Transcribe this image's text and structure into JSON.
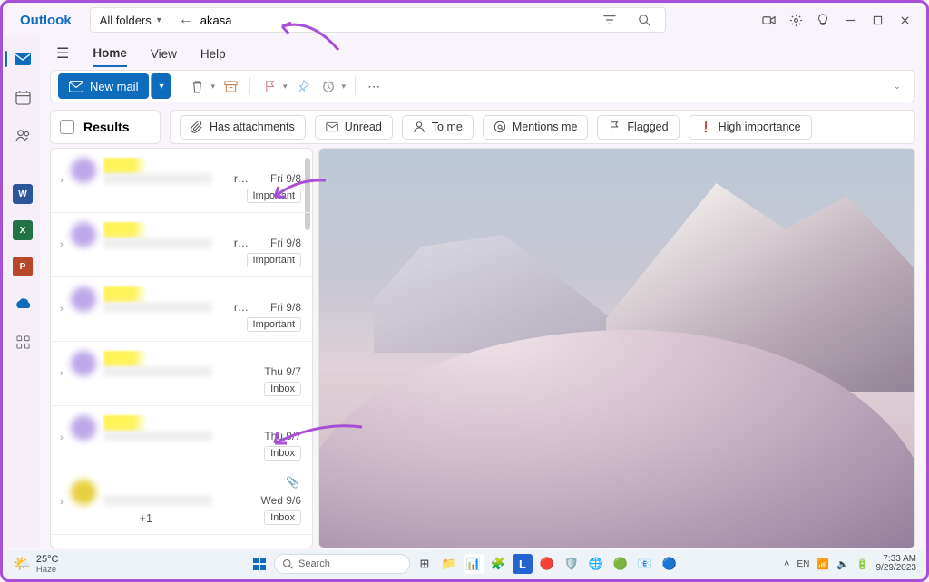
{
  "app": {
    "name": "Outlook"
  },
  "titlebar": {
    "folder_scope": "All folders",
    "search_value": "akasa"
  },
  "toolbar_icons": {
    "filter": "filter-icon",
    "search": "search-icon",
    "meet": "meet-now-icon",
    "settings": "gear-icon",
    "tips": "lightbulb-icon",
    "min": "minimize-icon",
    "max": "maximize-icon",
    "close": "close-icon"
  },
  "tabs": {
    "home": "Home",
    "view": "View",
    "help": "Help"
  },
  "ribbon": {
    "new_mail": "New mail"
  },
  "results_header": "Results",
  "filters": {
    "has_attachments": "Has attachments",
    "unread": "Unread",
    "to_me": "To me",
    "mentions_me": "Mentions me",
    "flagged": "Flagged",
    "high_importance": "High importance"
  },
  "messages": [
    {
      "sender_r": "r…",
      "date": "Fri 9/8",
      "folder": "Important",
      "avatar": "#bda7e9",
      "highlight": true
    },
    {
      "sender_r": "r…",
      "date": "Fri 9/8",
      "folder": "Important",
      "avatar": "#bda7e9",
      "highlight": true
    },
    {
      "sender_r": "r…",
      "date": "Fri 9/8",
      "folder": "Important",
      "avatar": "#bda7e9",
      "highlight": true
    },
    {
      "sender_r": "",
      "date": "Thu 9/7",
      "folder": "Inbox",
      "avatar": "#bda7e9",
      "highlight": true
    },
    {
      "sender_r": "",
      "date": "Thu 9/7",
      "folder": "Inbox",
      "avatar": "#bda7e9",
      "highlight": true
    },
    {
      "sender_r": "",
      "date": "Wed 9/6",
      "folder": "Inbox",
      "avatar": "#e6cf3f",
      "highlight": false,
      "attachment": true,
      "plusone": "+1"
    }
  ],
  "taskbar": {
    "temp": "25°C",
    "cond": "Haze",
    "search_placeholder": "Search",
    "time": "7:33 AM",
    "date": "9/29/2023"
  }
}
